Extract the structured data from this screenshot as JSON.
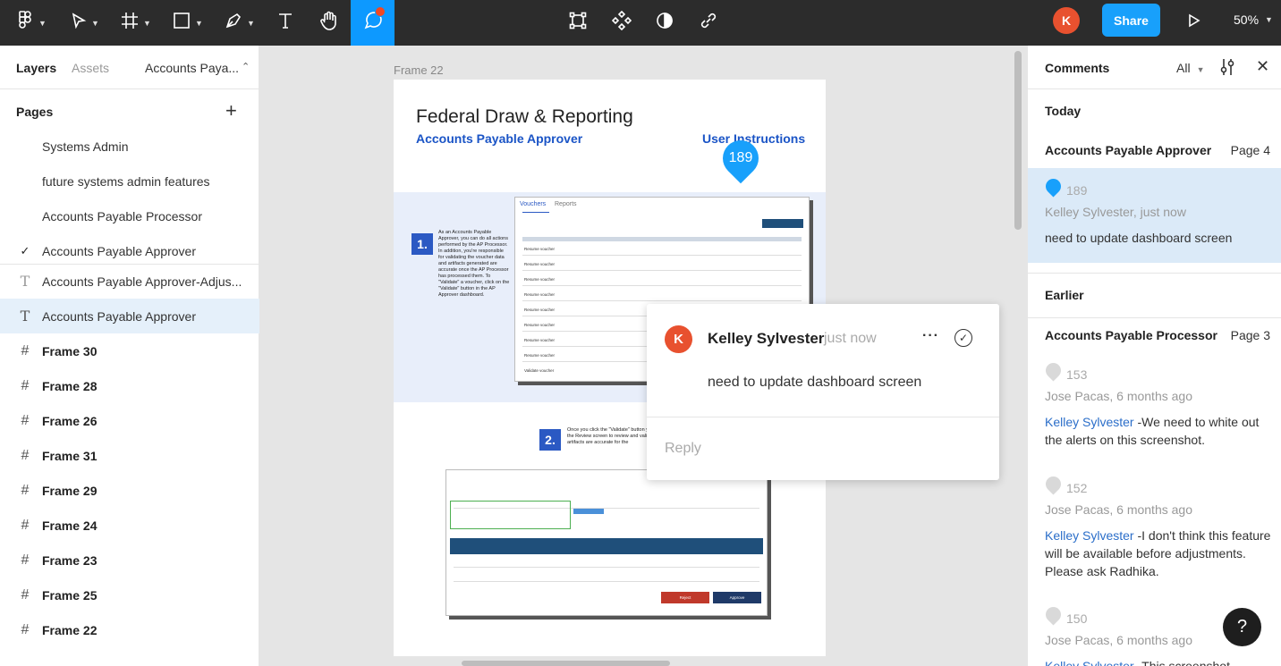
{
  "toolbar": {
    "avatar_initial": "K",
    "share_label": "Share",
    "zoom_label": "50%",
    "tools": [
      "main-menu-icon",
      "move-icon",
      "frame-icon",
      "rectangle-icon",
      "pen-icon",
      "text-icon",
      "hand-icon",
      "comment-icon"
    ],
    "center_tools": [
      "edit-object-icon",
      "component-icon",
      "mask-icon",
      "link-icon"
    ],
    "accent": "#0d99ff"
  },
  "left_panel": {
    "tab_layers": "Layers",
    "tab_assets": "Assets",
    "page_dropdown": "Accounts Paya...",
    "pages_heading": "Pages",
    "pages": [
      {
        "label": "Systems Admin"
      },
      {
        "label": "future systems admin features"
      },
      {
        "label": "Accounts Payable Processor"
      },
      {
        "label": "Accounts Payable Approver",
        "checked": true
      }
    ],
    "layers": [
      {
        "type": "text",
        "label": "Accounts Payable Approver-Adjus..."
      },
      {
        "type": "text",
        "label": "Accounts Payable Approver",
        "selected": true
      },
      {
        "type": "frame",
        "label": "Frame 30"
      },
      {
        "type": "frame",
        "label": "Frame 28"
      },
      {
        "type": "frame",
        "label": "Frame 26"
      },
      {
        "type": "frame",
        "label": "Frame 31"
      },
      {
        "type": "frame",
        "label": "Frame 29"
      },
      {
        "type": "frame",
        "label": "Frame 24"
      },
      {
        "type": "frame",
        "label": "Frame 23"
      },
      {
        "type": "frame",
        "label": "Frame 25"
      },
      {
        "type": "frame",
        "label": "Frame 22"
      }
    ]
  },
  "canvas": {
    "frame_label": "Frame 22",
    "doc_title": "Federal Draw & Reporting",
    "doc_subtitle": "Accounts Payable Approver",
    "doc_link": "User Instructions",
    "pin_number": "189",
    "step1_num": "1.",
    "step1_text": "As an Accounts Payable Approver, you can do all actions performed by the AP Processor. In addition, you're responsible for validating the voucher data and artifacts generated are accurate once the AP Processor has processed them. To \"Validate\" a voucher, click on the \"Validate\" button in the AP Approver dashboard.",
    "step2_num": "2.",
    "step2_text": "Once you click the \"Validate\" button you will go to the Review screen to review and validate that the artifacts are accurate for the",
    "shot_tabs": [
      "Vouchers",
      "Reports"
    ],
    "shot_rows": [
      "Resume voucher",
      "Resume voucher",
      "Resume voucher",
      "Resume voucher",
      "Resume voucher",
      "Resume voucher",
      "Resume voucher",
      "Resume voucher",
      "Validate voucher"
    ],
    "shot_buttons": [
      "Reject",
      "Approve"
    ]
  },
  "popup": {
    "avatar_initial": "K",
    "author": "Kelley Sylvester",
    "time": "just now",
    "message": "need to update dashboard screen",
    "reply_placeholder": "Reply"
  },
  "comments_panel": {
    "title": "Comments",
    "filter": "All",
    "section_today": "Today",
    "section_earlier": "Earlier",
    "today_group": {
      "page_name": "Accounts Payable Approver",
      "page_num": "Page 4"
    },
    "today_comments": [
      {
        "num": "189",
        "meta": "Kelley Sylvester, just now",
        "text": "need to update dashboard screen",
        "color": "#18a0fb"
      }
    ],
    "earlier_group": {
      "page_name": "Accounts Payable Processor",
      "page_num": "Page 3"
    },
    "earlier_comments": [
      {
        "num": "153",
        "meta": "Jose Pacas, 6 months ago",
        "mention": "Kelley Sylvester",
        "text": " -We need to white out the alerts on this screenshot."
      },
      {
        "num": "152",
        "meta": "Jose Pacas, 6 months ago",
        "mention": "Kelley Sylvester",
        "text": " -I don't think this feature will be available before adjustments. Please ask Radhika."
      },
      {
        "num": "150",
        "meta": "Jose Pacas, 6 months ago",
        "mention": "Kelley Sylvester",
        "text": " -This screenshot"
      }
    ]
  },
  "help_label": "?"
}
